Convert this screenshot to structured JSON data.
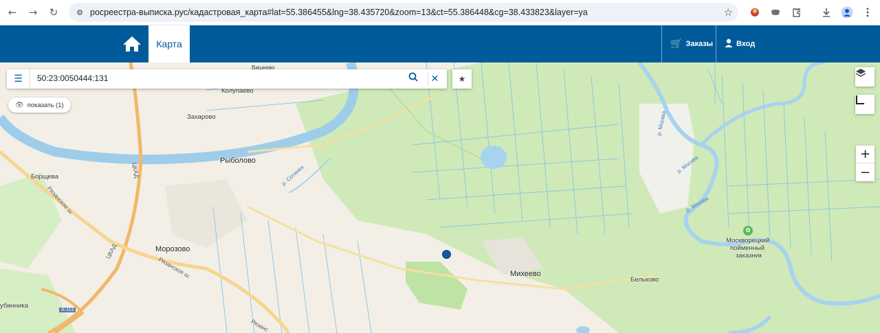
{
  "browser": {
    "url": "росреестра-выписка.рус/кадастровая_карта#lat=55.386455&lng=38.435720&zoom=13&ct=55.386448&cg=38.433823&layer=ya",
    "back_icon": "←",
    "forward_icon": "→",
    "reload_icon": "↻",
    "star_icon": "☆"
  },
  "header": {
    "home_icon": "home-icon",
    "map_tab": "Карта",
    "orders_label": "Заказы",
    "login_label": "Вход"
  },
  "search": {
    "value": "50:23:0050444:131",
    "show_label": "показать (1)"
  },
  "map": {
    "places": [
      "Колупаево",
      "Захарово",
      "Рыболово",
      "Борщева",
      "Морозово",
      "Михеево",
      "Бельково",
      "Москворецкий",
      "пойменный",
      "заказник",
      "убинника",
      "Вишнево"
    ],
    "roads": [
      "ЦКАД",
      "ЦКАД",
      "Рязанское ш.",
      "Рязанское ш.",
      "Рязанс",
      "А-113"
    ],
    "rivers": [
      "р. Сотинка",
      "р. Москва",
      "р. Москва",
      "р. Москва"
    ],
    "zoom_in": "+",
    "zoom_out": "−"
  },
  "colors": {
    "brand": "#005b9a",
    "forest": "#cfeab8",
    "water": "#b3d8f2"
  }
}
